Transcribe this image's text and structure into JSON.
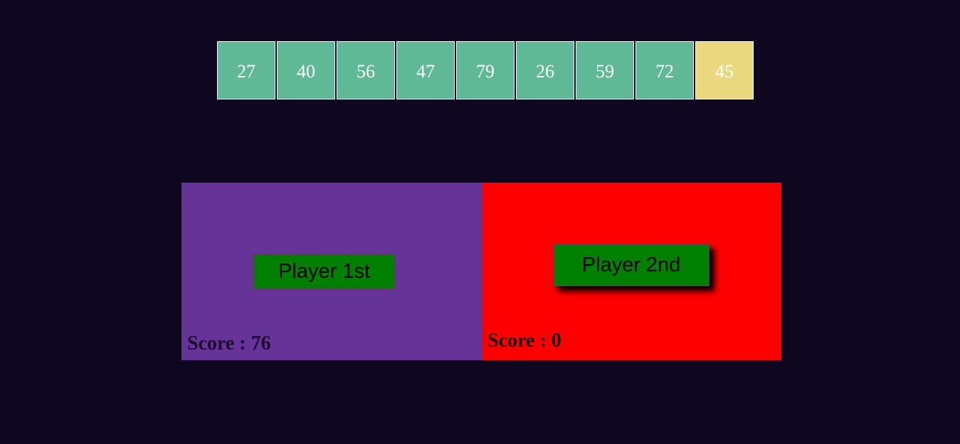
{
  "colors": {
    "background": "#0f0720",
    "card": "#5fb896",
    "card_highlight": "#ead87e",
    "player1_panel": "#663399",
    "player2_panel": "#ff0000",
    "button": "#008000"
  },
  "cards": [
    {
      "value": "27",
      "highlighted": false
    },
    {
      "value": "40",
      "highlighted": false
    },
    {
      "value": "56",
      "highlighted": false
    },
    {
      "value": "47",
      "highlighted": false
    },
    {
      "value": "79",
      "highlighted": false
    },
    {
      "value": "26",
      "highlighted": false
    },
    {
      "value": "59",
      "highlighted": false
    },
    {
      "value": "72",
      "highlighted": false
    },
    {
      "value": "45",
      "highlighted": true
    }
  ],
  "player1": {
    "button_label": "Player 1st",
    "score_text": "Score : 76"
  },
  "player2": {
    "button_label": "Player 2nd",
    "score_text": "Score : 0"
  }
}
